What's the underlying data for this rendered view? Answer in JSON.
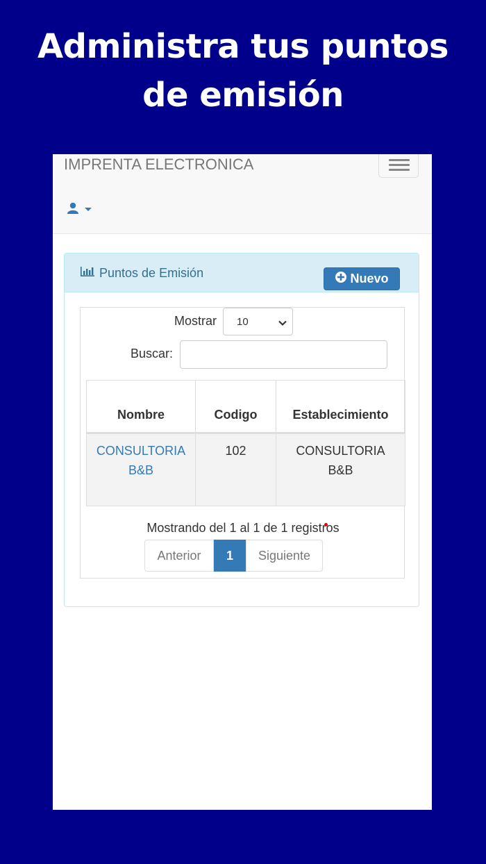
{
  "promo": {
    "title_line1": "Administra tus puntos",
    "title_line2": "de emisión"
  },
  "navbar": {
    "brand": "IMPRENTA ELECTRONICA",
    "toggle_icon": "hamburger-icon",
    "user_icon": "user-icon"
  },
  "panel": {
    "icon": "bar-chart-icon",
    "title": "Puntos de Emisión",
    "new_button_icon": "plus-circle-icon",
    "new_button_label": "Nuevo"
  },
  "controls": {
    "show_label": "Mostrar",
    "show_value": "10",
    "search_label": "Buscar:",
    "search_value": ""
  },
  "table": {
    "headers": [
      "Nombre",
      "Codigo",
      "Establecimiento"
    ],
    "rows": [
      {
        "nombre_line1": "CONSULTORIA",
        "nombre_line2": "B&B",
        "codigo": "102",
        "establecimiento_line1": "CONSULTORIA",
        "establecimiento_line2": "B&B"
      }
    ]
  },
  "footer": {
    "info": "Mostrando del 1 al 1 de 1 registros",
    "prev": "Anterior",
    "current_page": "1",
    "next": "Siguiente"
  },
  "colors": {
    "background": "#00008b",
    "primary": "#337ab7",
    "panel_heading": "#d9edf7"
  }
}
